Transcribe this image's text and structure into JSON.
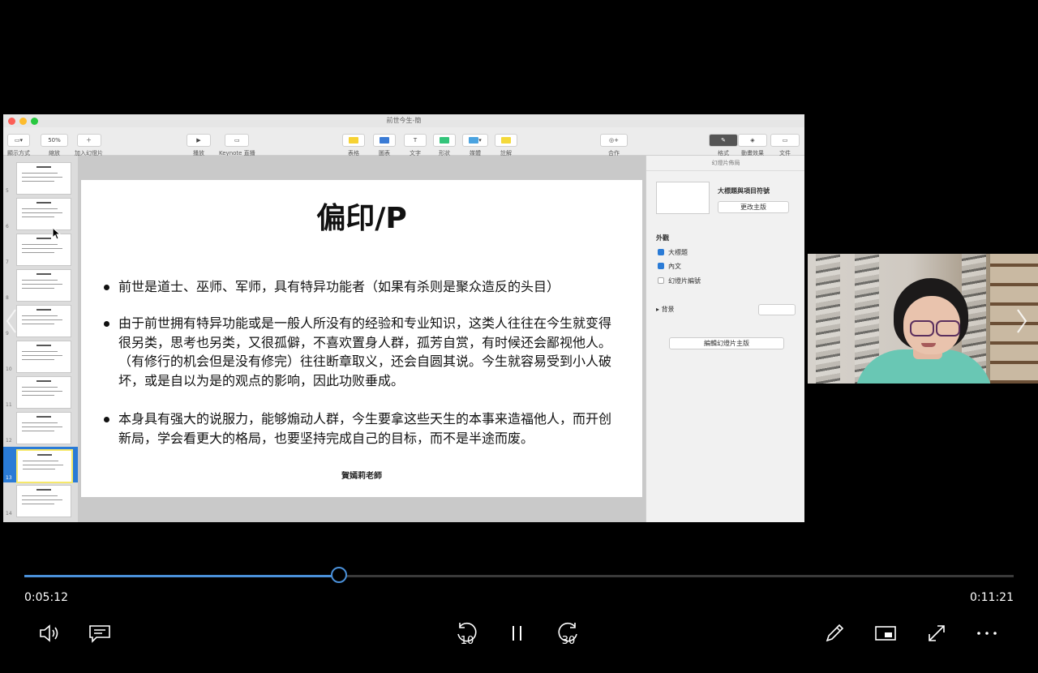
{
  "keynote": {
    "window_title": "前世今生-簡",
    "toolbar": {
      "view": "顯示方式",
      "zoom_value": "50%",
      "zoom": "縮放",
      "add_slide": "加入幻燈片",
      "play": "播放",
      "keynote_live": "Keynote 直播",
      "table": "表格",
      "chart": "圖表",
      "text": "文字",
      "shape": "形狀",
      "media": "媒體",
      "comment": "註解",
      "collaborate": "合作",
      "format": "格式",
      "animate": "動畫效果",
      "document": "文件"
    },
    "navigator": {
      "slide_numbers": [
        "5",
        "6",
        "7",
        "8",
        "9",
        "10",
        "11",
        "12",
        "13",
        "14"
      ],
      "selected_slide": "13"
    },
    "slide": {
      "title": "偏印/P",
      "bullets": [
        "前世是道士、巫师、军师，具有特异功能者（如果有杀则是聚众造反的头目）",
        "由于前世拥有特异功能或是一般人所没有的经验和专业知识，这类人往往在今生就变得很另类，思考也另类，又很孤僻，不喜欢置身人群，孤芳自赏，有时候还会鄙视他人。（有修行的机会但是没有修完）往往断章取义，还会自圆其说。今生就容易受到小人破坏，或是自以为是的观点的影响，因此功败垂成。",
        "本身具有强大的说服力，能够煽动人群，今生要拿这些天生的本事来造福他人，而开创新局，学会看更大的格局，也要坚持完成自己的目标，而不是半途而废。"
      ],
      "footer": "賀嫣莉老師"
    },
    "inspector": {
      "header": "幻燈片佈局",
      "layout_name": "大標題與項目符號",
      "change_master": "更改主版",
      "appearance": "外觀",
      "title_option": "大標題",
      "body_option": "內文",
      "slide_number_option": "幻燈片編號",
      "background": "背景",
      "edit_master": "編輯幻燈片主版"
    }
  },
  "player": {
    "current_time": "0:05:12",
    "total_time": "0:11:21",
    "progress": 0.318,
    "rewind_seconds": "10",
    "forward_seconds": "30"
  },
  "colors": {
    "accent": "#4a90d9",
    "selection": "#2a7bd6"
  }
}
